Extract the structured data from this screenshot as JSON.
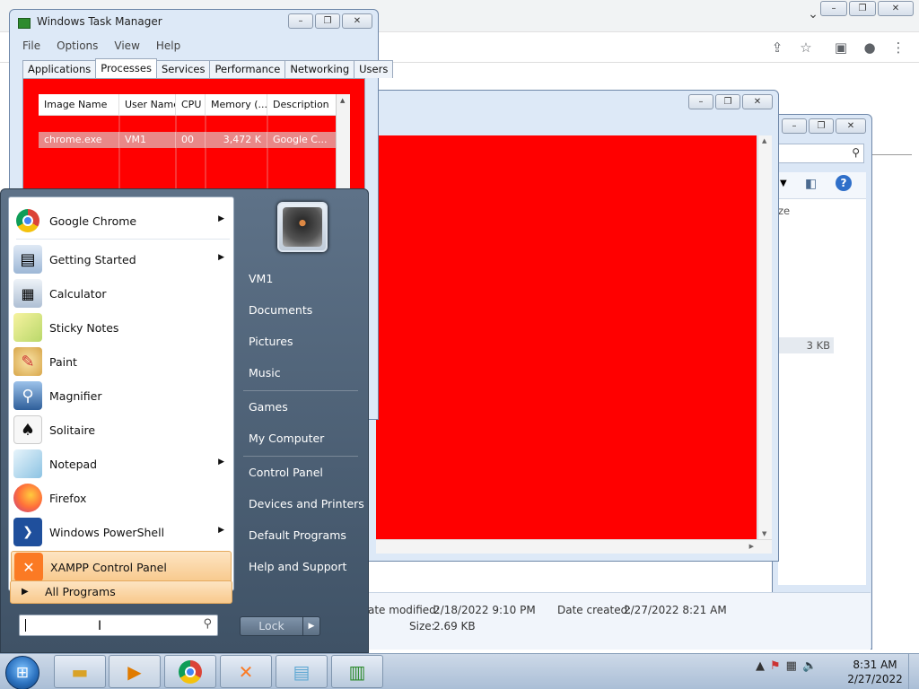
{
  "browser": {
    "chevron": "⌄",
    "win_min": "–",
    "win_max": "❐",
    "win_close": "✕",
    "toolbar_icons": [
      "share-icon",
      "star-icon",
      "sidebar-icon",
      "profile-icon",
      "menu-icon"
    ]
  },
  "task_manager": {
    "title": "Windows Task Manager",
    "menu": [
      "File",
      "Options",
      "View",
      "Help"
    ],
    "tabs": [
      "Applications",
      "Processes",
      "Services",
      "Performance",
      "Networking",
      "Users"
    ],
    "active_tab": "Processes",
    "columns": [
      "Image Name",
      "User Name",
      "CPU",
      "Memory (...",
      "Description"
    ],
    "rows": [
      {
        "image": "chrome.exe",
        "user": "VM1",
        "cpu": "00",
        "memory": "3,472 K",
        "description": "Google C..."
      }
    ]
  },
  "explorer": {
    "size_label_partial": "ze",
    "file_size": "3 KB",
    "details": {
      "modified_label": "ate modified:",
      "modified_value": "2/18/2022 9:10 PM",
      "created_label": "Date created:",
      "created_value": "2/27/2022 8:21 AM",
      "size_label": "Size:",
      "size_value": "2.69 KB"
    }
  },
  "start_menu": {
    "programs": [
      {
        "label": "Google Chrome",
        "icon": "chrome-icon",
        "submenu": true
      },
      {
        "label": "Getting Started",
        "icon": "getting-started-icon",
        "submenu": true
      },
      {
        "label": "Calculator",
        "icon": "calculator-icon",
        "submenu": false
      },
      {
        "label": "Sticky Notes",
        "icon": "sticky-notes-icon",
        "submenu": false
      },
      {
        "label": "Paint",
        "icon": "paint-icon",
        "submenu": false
      },
      {
        "label": "Magnifier",
        "icon": "magnifier-icon",
        "submenu": false
      },
      {
        "label": "Solitaire",
        "icon": "solitaire-icon",
        "submenu": false
      },
      {
        "label": "Notepad",
        "icon": "notepad-icon",
        "submenu": true
      },
      {
        "label": "Firefox",
        "icon": "firefox-icon",
        "submenu": false
      },
      {
        "label": "Windows PowerShell",
        "icon": "powershell-icon",
        "submenu": true
      },
      {
        "label": "XAMPP Control Panel",
        "icon": "xampp-icon",
        "submenu": false
      }
    ],
    "all_programs": "All Programs",
    "search_placeholder": "",
    "right_links": [
      "VM1",
      "Documents",
      "Pictures",
      "Music",
      "Games",
      "My Computer",
      "Control Panel",
      "Devices and Printers",
      "Default Programs",
      "Help and Support"
    ],
    "lock_label": "Lock"
  },
  "taskbar": {
    "buttons": [
      "explorer-icon",
      "media-player-icon",
      "chrome-icon",
      "xampp-icon",
      "notepad-icon",
      "task-manager-icon"
    ],
    "time": "8:31 AM",
    "date": "2/27/2022"
  }
}
